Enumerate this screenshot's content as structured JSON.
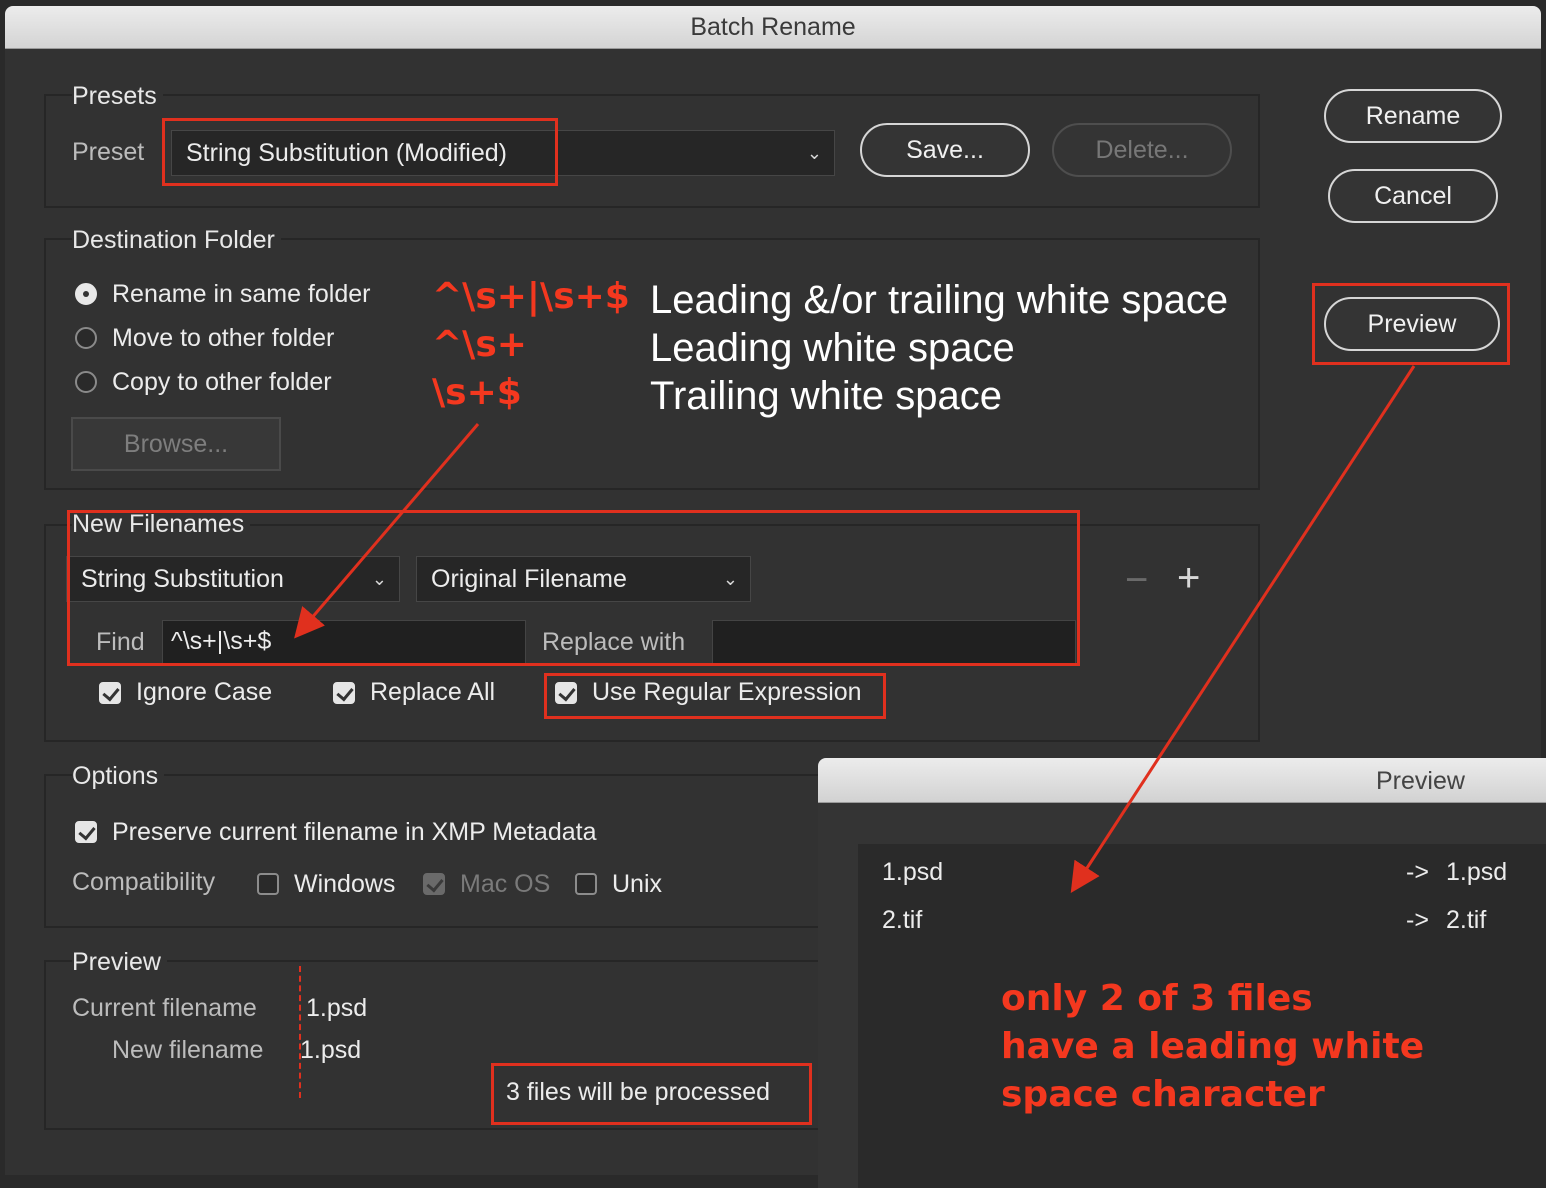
{
  "dialog": {
    "title": "Batch Rename",
    "buttons": {
      "rename": "Rename",
      "cancel": "Cancel",
      "preview": "Preview"
    }
  },
  "presets": {
    "group_title": "Presets",
    "preset_label": "Preset",
    "preset_value": "String Substitution (Modified)",
    "save_label": "Save...",
    "delete_label": "Delete..."
  },
  "destination": {
    "group_title": "Destination Folder",
    "options": [
      {
        "label": "Rename in same folder",
        "selected": true
      },
      {
        "label": "Move to other folder",
        "selected": false
      },
      {
        "label": "Copy to other folder",
        "selected": false
      }
    ],
    "browse_label": "Browse..."
  },
  "new_filenames": {
    "group_title": "New Filenames",
    "type_value": "String Substitution",
    "source_value": "Original Filename",
    "find_label": "Find",
    "find_value": "^\\s+|\\s+$",
    "replace_label": "Replace with",
    "replace_value": "",
    "minus_label": "−",
    "plus_label": "+",
    "ignore_case": {
      "label": "Ignore Case",
      "checked": true
    },
    "replace_all": {
      "label": "Replace All",
      "checked": true
    },
    "use_regex": {
      "label": "Use Regular Expression",
      "checked": true
    }
  },
  "options": {
    "group_title": "Options",
    "preserve": {
      "label": "Preserve current filename in XMP Metadata",
      "checked": true
    },
    "compat_label": "Compatibility",
    "windows": {
      "label": "Windows",
      "checked": false
    },
    "macos": {
      "label": "Mac OS",
      "checked": true
    },
    "unix": {
      "label": "Unix",
      "checked": false
    }
  },
  "preview_group": {
    "group_title": "Preview",
    "current_label": "Current filename",
    "current_value": "1.psd",
    "new_label": "New filename",
    "new_value": "1.psd",
    "count_text": "3 files will be processed"
  },
  "annotations": {
    "regex_1": "^\\s+|\\s+$",
    "regex_2": "^\\s+",
    "regex_3": "\\s+$",
    "desc_1": "Leading &/or trailing white space",
    "desc_2": "Leading white space",
    "desc_3": "Trailing white space",
    "note_lines": [
      "only 2 of 3 files",
      "have a leading white",
      "space character"
    ]
  },
  "preview_window": {
    "title": "Preview",
    "rows": [
      {
        "from": "1.psd",
        "arrow": "->",
        "to": "1.psd"
      },
      {
        "from": "2.tif",
        "arrow": "->",
        "to": "2.tif"
      }
    ]
  },
  "colors": {
    "annotation_red": "#e0301e",
    "background": "#323232"
  }
}
